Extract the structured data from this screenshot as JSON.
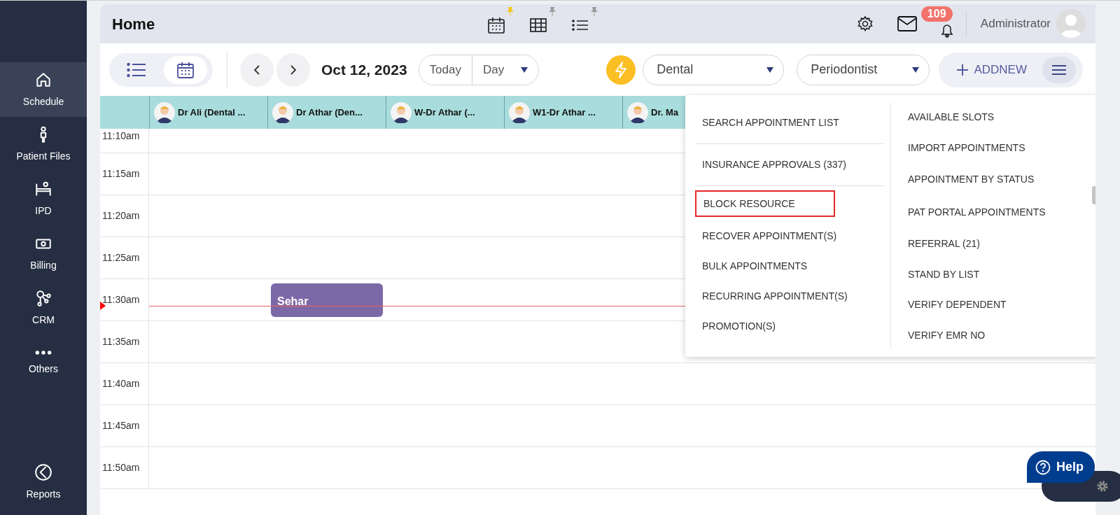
{
  "sidebar": {
    "items": [
      {
        "label": "Schedule",
        "selected": true
      },
      {
        "label": "Patient Files",
        "selected": false
      },
      {
        "label": "IPD",
        "selected": false
      },
      {
        "label": "Billing",
        "selected": false
      },
      {
        "label": "CRM",
        "selected": false
      },
      {
        "label": "Others",
        "selected": false
      },
      {
        "label": "Reports",
        "selected": false
      }
    ]
  },
  "header": {
    "title": "Home",
    "shortcuts": [
      {
        "pinned": true
      },
      {
        "pinned": false
      },
      {
        "pinned": false
      }
    ],
    "notifications": "109",
    "user": "Administrator"
  },
  "toolbar": {
    "views": [
      {
        "selected": false
      },
      {
        "selected": true
      }
    ],
    "date": "Oct 12, 2023",
    "today": "Today",
    "range": "Day",
    "department": "Dental",
    "specialty": "Periodontist",
    "add": "ADDNEW",
    "menu_expanded": true
  },
  "resources": [
    {
      "name": "Dr Ali (Dental ..."
    },
    {
      "name": "Dr Athar (Den..."
    },
    {
      "name": "W-Dr Athar (..."
    },
    {
      "name": "W1-Dr Athar ..."
    },
    {
      "name": "Dr. Ma"
    }
  ],
  "slots": [
    {
      "time": "11:10am",
      "now": false
    },
    {
      "time": "11:15am",
      "now": false
    },
    {
      "time": "11:20am",
      "now": false
    },
    {
      "time": "11:25am",
      "now": false
    },
    {
      "time": "11:30am",
      "now": true,
      "cells": [
        null,
        {
          "title": "Sehar"
        }
      ]
    },
    {
      "time": "11:35am",
      "now": false
    },
    {
      "time": "11:40am",
      "now": false
    },
    {
      "time": "11:45am",
      "now": false
    },
    {
      "time": "11:50am",
      "now": false
    }
  ],
  "menu": {
    "left": [
      {
        "label": "SEARCH APPOINTMENT LIST",
        "separated": true,
        "highlighted": false
      },
      {
        "label": "INSURANCE APPROVALS (337)",
        "separated": true,
        "highlighted": false
      },
      {
        "label": "BLOCK RESOURCE",
        "separated": false,
        "highlighted": true
      },
      {
        "label": "RECOVER APPOINTMENT(S)",
        "separated": false,
        "highlighted": false
      },
      {
        "label": "BULK APPOINTMENTS",
        "separated": false,
        "highlighted": false
      },
      {
        "label": "RECURRING APPOINTMENT(S)",
        "separated": false,
        "highlighted": false
      },
      {
        "label": "PROMOTION(S)",
        "separated": false,
        "highlighted": false
      }
    ],
    "right": [
      {
        "label": "AVAILABLE SLOTS"
      },
      {
        "label": "IMPORT APPOINTMENTS"
      },
      {
        "label": "APPOINTMENT BY STATUS"
      },
      {
        "label": "PAT PORTAL APPOINTMENTS"
      },
      {
        "label": "REFERRAL (21)"
      },
      {
        "label": "STAND BY LIST"
      },
      {
        "label": "VERIFY DEPENDENT"
      },
      {
        "label": "VERIFY EMR NO"
      }
    ]
  },
  "help": "Help"
}
